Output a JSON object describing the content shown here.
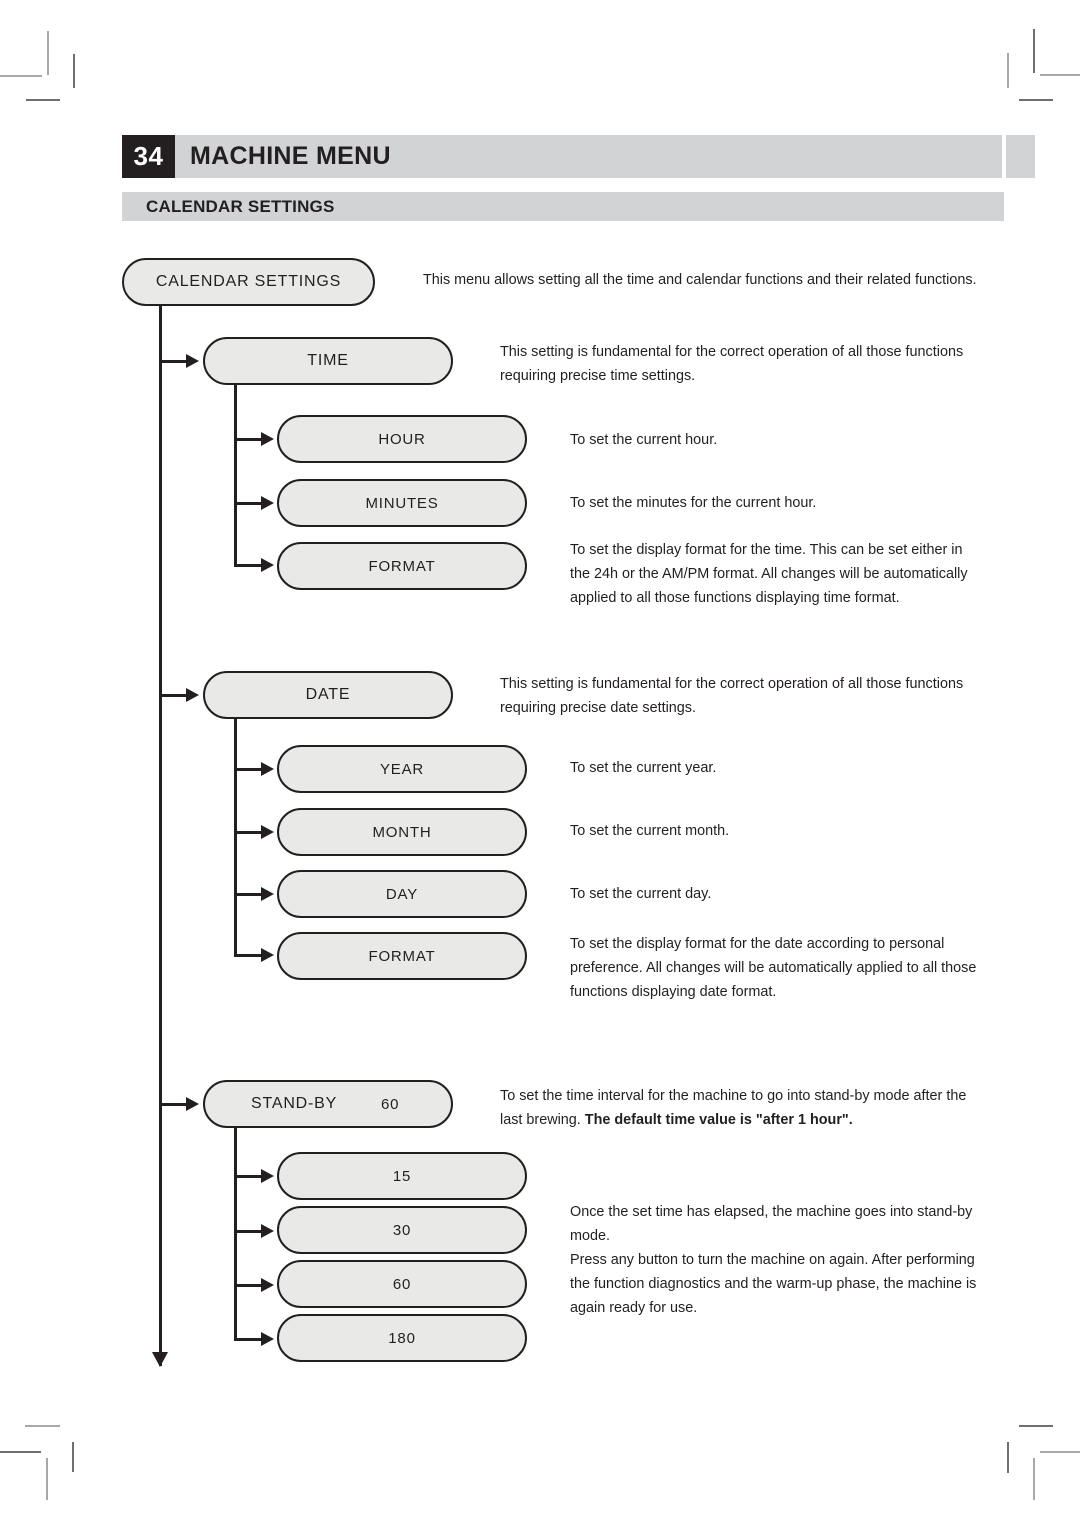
{
  "header": {
    "page_number": "34",
    "title": "MACHINE MENU",
    "section_title": "CALENDAR SETTINGS"
  },
  "flow": {
    "root": {
      "label": "CALENDAR SETTINGS",
      "description": "This menu allows setting all the time and calendar functions and their related functions."
    },
    "branches": [
      {
        "label": "TIME",
        "description": "This setting is fundamental for the correct operation of all those functions requiring precise time settings.",
        "children": [
          {
            "label": "HOUR",
            "description": "To set the current hour."
          },
          {
            "label": "MINUTES",
            "description": "To set the minutes for the current hour."
          },
          {
            "label": "FORMAT",
            "description": "To set the display format for the time. This can be set either in the 24h or the AM/PM format. All changes will be automatically applied to all those functions displaying time format."
          }
        ]
      },
      {
        "label": "DATE",
        "description": "This setting is fundamental for the correct operation of all those functions requiring precise date settings.",
        "children": [
          {
            "label": "YEAR",
            "description": "To set the current year."
          },
          {
            "label": "MONTH",
            "description": "To set the current month."
          },
          {
            "label": "DAY",
            "description": "To set the current day."
          },
          {
            "label": "FORMAT",
            "description": "To set the display format for the date according to personal preference. All changes will be automatically applied to all those functions displaying date format."
          }
        ]
      },
      {
        "label": "STAND-BY",
        "value": "60",
        "description_prefix": "To set the time interval for the machine to go into stand-by mode after the last brewing. ",
        "description_bold": "The default time value is \"after 1 hour\".",
        "children": [
          {
            "label": "15",
            "description": ""
          },
          {
            "label": "30",
            "description": "Once the set time has elapsed, the machine goes into stand-by mode."
          },
          {
            "label": "60",
            "description": "Press any button to turn the machine on again. After performing the function diagnostics and the warm-up phase, the machine is again ready for use."
          },
          {
            "label": "180",
            "description": ""
          }
        ]
      }
    ]
  },
  "colors": {
    "header_bar": "#d2d3d5",
    "badge": "#231f20",
    "node_fill": "#e9eae8",
    "stroke": "#231f20"
  }
}
